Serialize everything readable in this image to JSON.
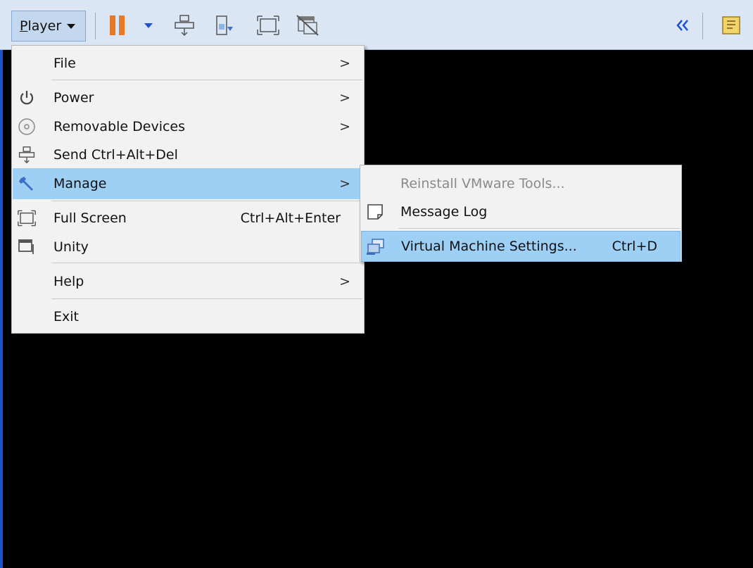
{
  "toolbar": {
    "player_label": "Player",
    "player_label_first": "P",
    "player_label_rest": "layer",
    "colors": {
      "background": "#dbe6f4",
      "pause": "#e8792b",
      "accent": "#1f4fd6"
    },
    "icons": [
      "pause-icon",
      "dropdown-arrow-icon",
      "send-ctrl-alt-del-icon",
      "removable-device-icon",
      "fullscreen-icon",
      "unity-icon",
      "collapse-chevrons-icon",
      "library-icon"
    ]
  },
  "menu": {
    "items": [
      {
        "label": "File",
        "submenu": true
      },
      {
        "label": "Power",
        "submenu": true
      },
      {
        "label": "Removable Devices",
        "submenu": true
      },
      {
        "label": "Send Ctrl+Alt+Del"
      },
      {
        "label": "Manage",
        "submenu": true,
        "highlighted": true
      },
      {
        "label": "Full Screen",
        "shortcut": "Ctrl+Alt+Enter"
      },
      {
        "label": "Unity"
      },
      {
        "label": "Help",
        "submenu": true
      },
      {
        "label": "Exit"
      }
    ],
    "arrow": ">"
  },
  "submenu": {
    "items": [
      {
        "label": "Reinstall VMware Tools...",
        "disabled": true
      },
      {
        "label": "Message Log"
      },
      {
        "label": "Virtual Machine Settings...",
        "shortcut": "Ctrl+D",
        "highlighted": true
      }
    ]
  },
  "colors": {
    "highlight": "#9ecff5",
    "menu_bg": "#f2f2f2",
    "vm_screen": "#000000"
  }
}
